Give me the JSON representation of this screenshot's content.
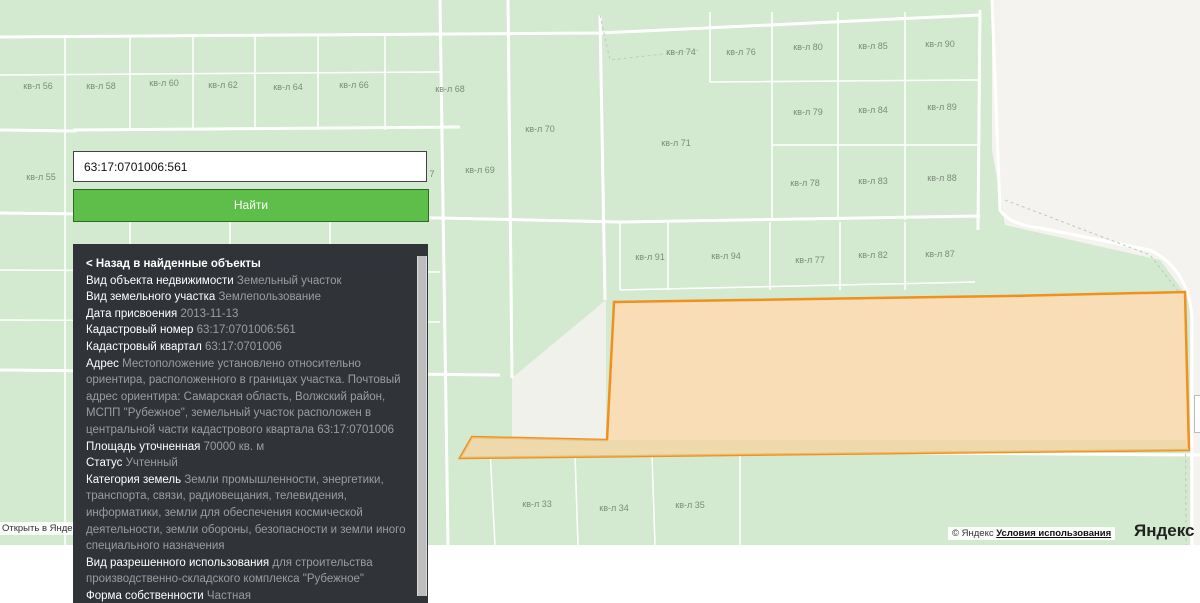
{
  "search": {
    "value": "63:17:0701006:561",
    "button_label": "Найти"
  },
  "info": {
    "back_label": "< Назад в найденные объекты",
    "rows": [
      {
        "k": "Вид объекта недвижимости",
        "v": "Земельный участок"
      },
      {
        "k": "Вид земельного участка",
        "v": "Землепользование"
      },
      {
        "k": "Дата присвоения",
        "v": "2013-11-13"
      },
      {
        "k": "Кадастровый номер",
        "v": "63:17:0701006:561"
      },
      {
        "k": "Кадастровый квартал",
        "v": "63:17:0701006"
      },
      {
        "k": "Адрес",
        "v": "Местоположение установлено относительно ориентира, расположенного в границах участка. Почтовый адрес ориентира: Самарская область, Волжский район, МСПП \"Рубежное\", земельный участок расположен в центральной части кадастрового квартала 63:17:0701006"
      },
      {
        "k": "Площадь уточненная",
        "v": "70000 кв. м"
      },
      {
        "k": "Статус",
        "v": "Учтенный"
      },
      {
        "k": "Категория земель",
        "v": "Земли промышленности, энергетики, транспорта, связи, радиовещания, телевидения, информатики, земли для обеспечения космической деятельности, земли обороны, безопасности и земли иного специального назначения"
      },
      {
        "k": "Вид разрешенного использования",
        "v": "для строительства производственно-складского комплекса \"Рубежное\""
      },
      {
        "k": "Форма собственности",
        "v": "Частная"
      }
    ]
  },
  "map": {
    "quarter_labels": [
      "кв-л 56",
      "кв-л 58",
      "кв-л 60",
      "кв-л 62",
      "кв-л 64",
      "кв-л 66",
      "кв-л 68",
      "кв-л 70",
      "кв-л 71",
      "кв-л 74",
      "кв-л 76",
      "кв-л 80",
      "кв-л 85",
      "кв-л 90",
      "кв-л 79",
      "кв-л 84",
      "кв-л 89",
      "кв-л 55",
      "кв-л 69",
      "кв-л 78",
      "кв-л 83",
      "кв-л 88",
      "кв-л 91",
      "кв-л 94",
      "кв-л 77",
      "кв-л 82",
      "кв-л 87",
      "кв-л 33",
      "кв-л 34",
      "кв-л 35",
      "7"
    ],
    "open_in_yandex": "Открыть в Янде",
    "attribution_prefix": "© Яндекс",
    "terms_label": "Условия использования",
    "logo_text": "Яндекс К",
    "colors": {
      "parcel_fill": "#fcdcb3",
      "parcel_stroke": "#f0901e",
      "map_bg": "#d4ead0",
      "button": "#5dbe4a",
      "panel": "#303338"
    }
  }
}
